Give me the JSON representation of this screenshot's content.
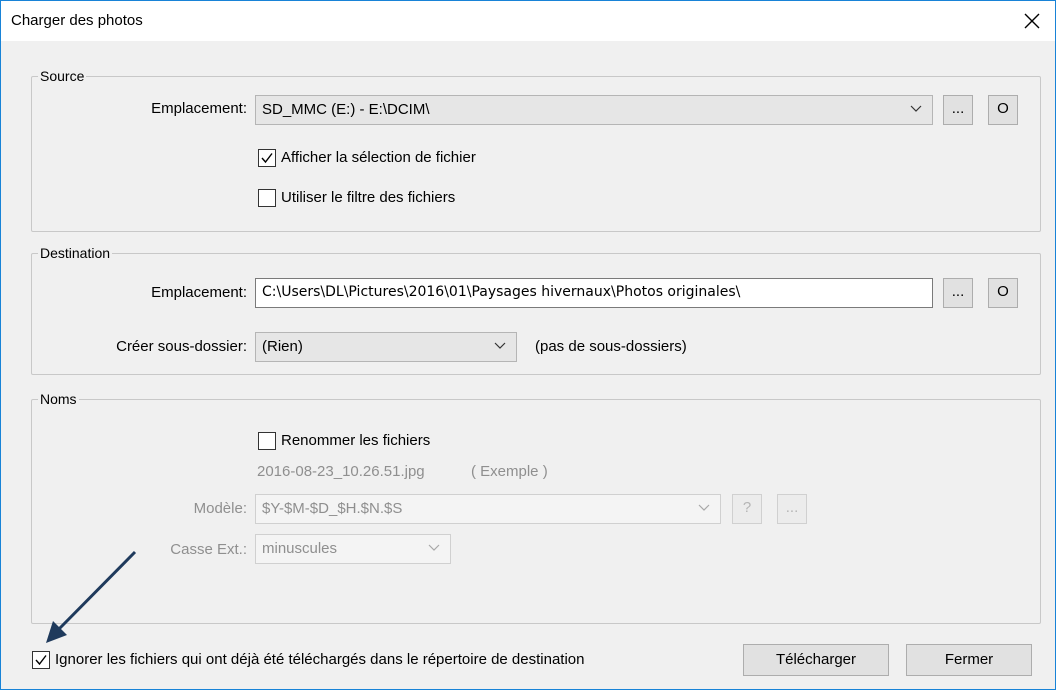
{
  "window": {
    "title": "Charger des photos",
    "close_glyph": "✕"
  },
  "source": {
    "legend": "Source",
    "location_label": "Emplacement:",
    "location_value": "SD_MMC (E:) - E:\\DCIM\\",
    "browse_label": "...",
    "open_label": "O",
    "show_selection": {
      "label": "Afficher la sélection de fichier",
      "checked": true
    },
    "use_filter": {
      "label": "Utiliser le filtre des fichiers",
      "checked": false
    }
  },
  "destination": {
    "legend": "Destination",
    "location_label": "Emplacement:",
    "location_value": "C:\\Users\\DL\\Pictures\\2016\\01\\Paysages hivernaux\\Photos originales\\",
    "browse_label": "...",
    "open_label": "O",
    "subfolder_label": "Créer sous-dossier:",
    "subfolder_value": "(Rien)",
    "subfolder_note": "(pas de sous-dossiers)"
  },
  "names": {
    "legend": "Noms",
    "rename": {
      "label": "Renommer les fichiers",
      "checked": false
    },
    "example_text": "2016-08-23_10.26.51.jpg",
    "example_note": "( Exemple )",
    "model_label": "Modèle:",
    "model_value": "$Y-$M-$D_$H.$N.$S",
    "help_label": "?",
    "more_label": "...",
    "case_label": "Casse Ext.:",
    "case_value": "minuscules"
  },
  "footer": {
    "ignore": {
      "label": "Ignorer les fichiers qui ont déjà été téléchargés dans le répertoire de destination",
      "checked": true
    },
    "download_label": "Télécharger",
    "close_label": "Fermer"
  },
  "colors": {
    "window_border": "#1883d7",
    "arrow": "#1f3a5c",
    "disabled_text": "#8f8f8f"
  },
  "icons": [
    "close-icon",
    "chevron-down-icon",
    "checkmark-icon",
    "arrow-annotation"
  ]
}
